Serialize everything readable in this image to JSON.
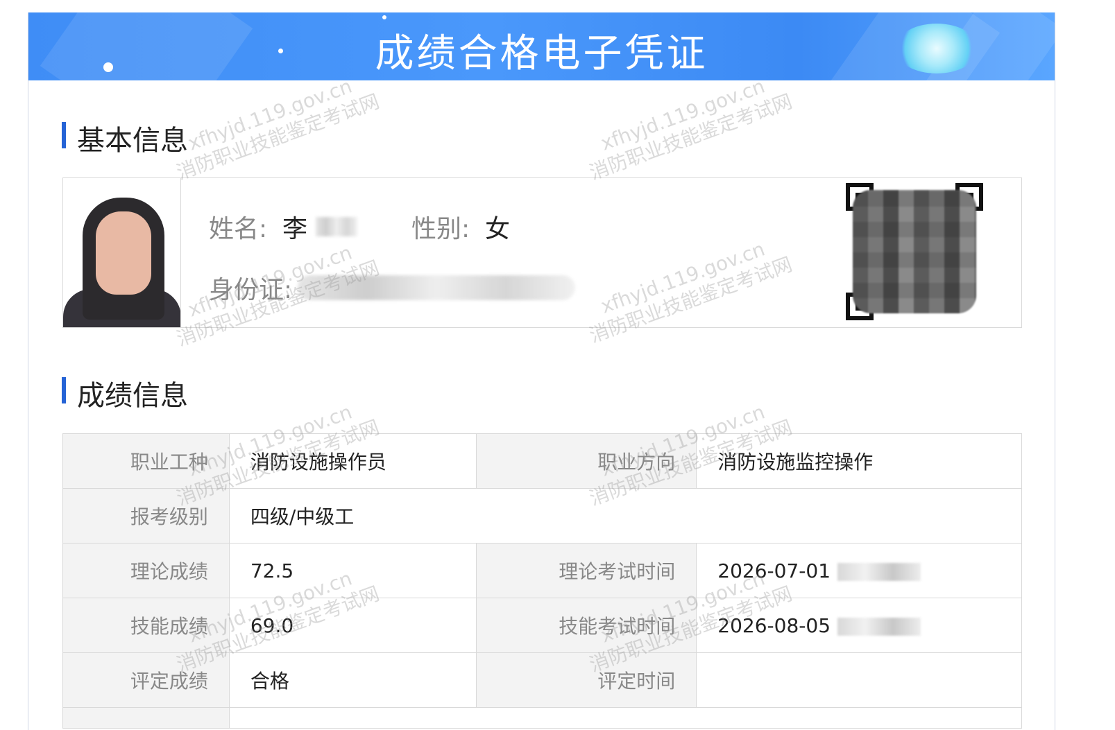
{
  "header": {
    "title": "成绩合格电子凭证"
  },
  "basic_section": {
    "title": "基本信息"
  },
  "person": {
    "name_label": "姓名:",
    "name_value": "李",
    "gender_label": "性别:",
    "gender_value": "女",
    "id_label": "身份证:"
  },
  "score_section": {
    "title": "成绩信息"
  },
  "table": {
    "occupation_label": "职业工种",
    "occupation_value": "消防设施操作员",
    "direction_label": "职业方向",
    "direction_value": "消防设施监控操作",
    "level_label": "报考级别",
    "level_value": "四级/中级工",
    "theory_label": "理论成绩",
    "theory_value": "72.5",
    "theory_time_label": "理论考试时间",
    "theory_time_value": "2026-07-01",
    "skill_label": "技能成绩",
    "skill_value": "69.0",
    "skill_time_label": "技能考试时间",
    "skill_time_value": "2026-08-05",
    "eval_label": "评定成绩",
    "eval_value": "合格",
    "eval_time_label": "评定时间",
    "eval_time_value": ""
  },
  "watermark": {
    "line1": "xfhyjd.119.gov.cn",
    "line2": "消防职业技能鉴定考试网"
  },
  "colors": {
    "banner": "#4a98fb",
    "accent": "#2563d6",
    "skill_score": "#3a86e8",
    "pass": "#2e9a3b"
  }
}
